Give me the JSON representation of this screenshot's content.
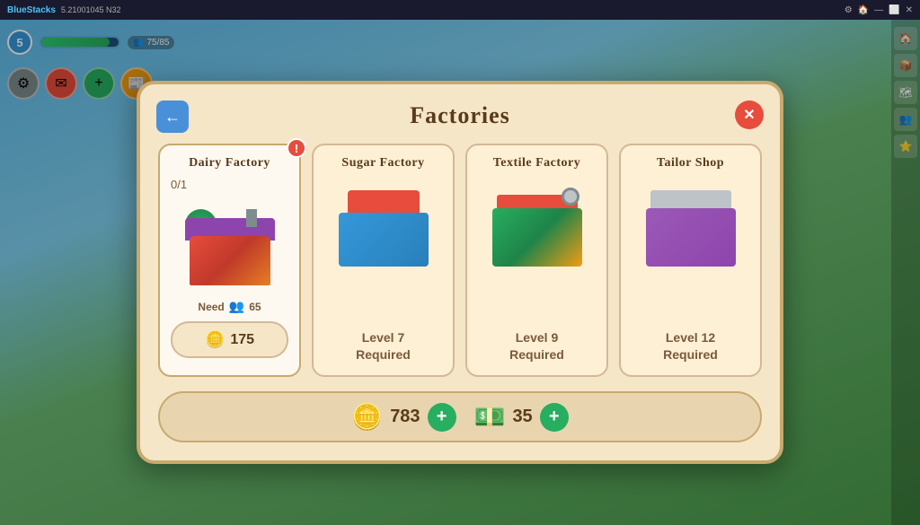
{
  "app": {
    "title": "BlueStacks",
    "version": "5.21001045 N32"
  },
  "gameHud": {
    "level": "5",
    "xpCurrent": "75",
    "xpMax": "85",
    "xpLabel": "75/85",
    "coins": "783",
    "bills": "35"
  },
  "dialog": {
    "title": "Factories",
    "backLabel": "←",
    "closeLabel": "✕",
    "factories": [
      {
        "id": "dairy",
        "name": "Dairy Factory",
        "count": "0/1",
        "status": "active",
        "hasAlert": true,
        "needLabel": "Need",
        "needValue": "65",
        "buyPrice": "175",
        "levelRequired": null
      },
      {
        "id": "sugar",
        "name": "Sugar Factory",
        "count": null,
        "status": "locked",
        "hasAlert": false,
        "levelRequired": "Level 7\nRequired"
      },
      {
        "id": "textile",
        "name": "Textile Factory",
        "count": null,
        "status": "locked",
        "hasAlert": false,
        "levelRequired": "Level 9\nRequired"
      },
      {
        "id": "tailor",
        "name": "Tailor Shop",
        "count": null,
        "status": "locked",
        "hasAlert": false,
        "levelRequired": "Level 12\nRequired"
      }
    ]
  },
  "currencyBar": {
    "coinsValue": "783",
    "billsValue": "35",
    "addCoinsLabel": "+",
    "addBillsLabel": "+"
  }
}
